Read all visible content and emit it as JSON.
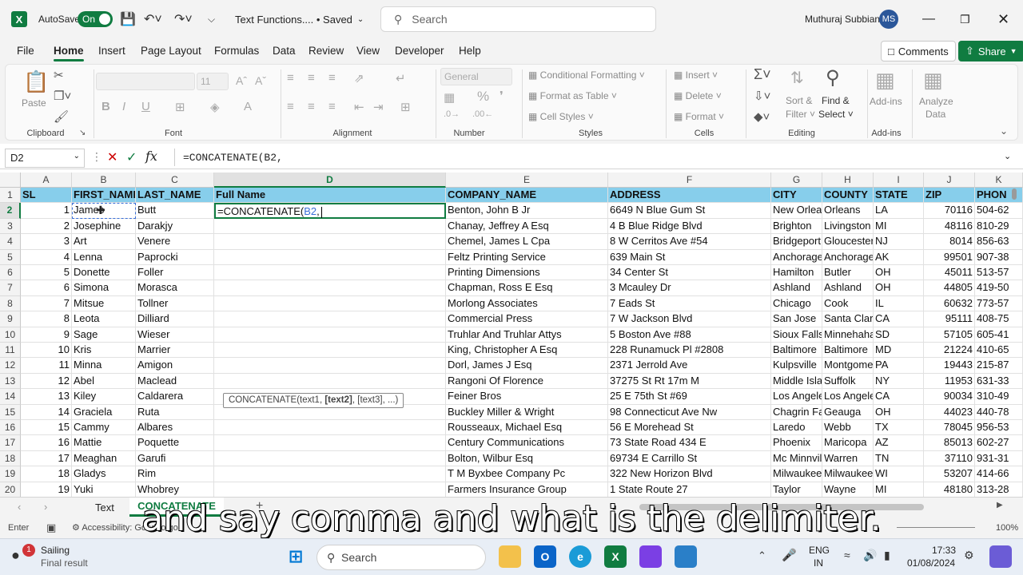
{
  "titlebar": {
    "autosave_label": "AutoSave",
    "autosave_state": "On",
    "doc_title": "Text Functions....  • Saved",
    "search_placeholder": "Search",
    "user_name": "Muthuraj Subbian",
    "user_initials": "MS"
  },
  "menu": {
    "tabs": [
      "File",
      "Home",
      "Insert",
      "Page Layout",
      "Formulas",
      "Data",
      "Review",
      "View",
      "Developer",
      "Help"
    ],
    "comments": "Comments",
    "share": "Share"
  },
  "ribbon": {
    "clipboard": {
      "label": "Clipboard",
      "paste": "Paste"
    },
    "font": {
      "label": "Font",
      "size": "11"
    },
    "alignment": {
      "label": "Alignment"
    },
    "number": {
      "label": "Number",
      "format": "General"
    },
    "styles": {
      "label": "Styles",
      "conditional": "Conditional Formatting",
      "format_table": "Format as Table",
      "cell_styles": "Cell Styles"
    },
    "cells": {
      "label": "Cells",
      "insert": "Insert",
      "delete": "Delete",
      "format": "Format"
    },
    "editing": {
      "label": "Editing",
      "sort": "Sort &",
      "filter": "Filter",
      "find": "Find &",
      "select": "Select"
    },
    "addins": {
      "label": "Add-ins",
      "addins": "Add-ins",
      "analyze": "Analyze",
      "data": "Data"
    }
  },
  "formula_bar": {
    "name_box": "D2",
    "formula": "=CONCATENATE(B2,"
  },
  "sheet": {
    "columns": [
      "A",
      "B",
      "C",
      "D",
      "E",
      "F",
      "G",
      "H",
      "I",
      "J",
      "K"
    ],
    "headers": [
      "SL",
      "FIRST_NAME",
      "LAST_NAME",
      "Full Name",
      "COMPANY_NAME",
      "ADDRESS",
      "CITY",
      "COUNTY",
      "STATE",
      "ZIP",
      "PHON"
    ],
    "rows": [
      [
        "1",
        "James",
        "Butt",
        "",
        "Benton, John B Jr",
        "6649 N Blue Gum St",
        "New Orleans",
        "Orleans",
        "LA",
        "70116",
        "504-62"
      ],
      [
        "2",
        "Josephine",
        "Darakjy",
        "",
        "Chanay, Jeffrey A Esq",
        "4 B Blue Ridge Blvd",
        "Brighton",
        "Livingston",
        "MI",
        "48116",
        "810-29"
      ],
      [
        "3",
        "Art",
        "Venere",
        "",
        "Chemel, James L Cpa",
        "8 W Cerritos Ave #54",
        "Bridgeport",
        "Gloucester",
        "NJ",
        "8014",
        "856-63"
      ],
      [
        "4",
        "Lenna",
        "Paprocki",
        "",
        "Feltz Printing Service",
        "639 Main St",
        "Anchorage",
        "Anchorage",
        "AK",
        "99501",
        "907-38"
      ],
      [
        "5",
        "Donette",
        "Foller",
        "",
        "Printing Dimensions",
        "34 Center St",
        "Hamilton",
        "Butler",
        "OH",
        "45011",
        "513-57"
      ],
      [
        "6",
        "Simona",
        "Morasca",
        "",
        "Chapman, Ross E Esq",
        "3 Mcauley Dr",
        "Ashland",
        "Ashland",
        "OH",
        "44805",
        "419-50"
      ],
      [
        "7",
        "Mitsue",
        "Tollner",
        "",
        "Morlong Associates",
        "7 Eads St",
        "Chicago",
        "Cook",
        "IL",
        "60632",
        "773-57"
      ],
      [
        "8",
        "Leota",
        "Dilliard",
        "",
        "Commercial Press",
        "7 W Jackson Blvd",
        "San Jose",
        "Santa Clara",
        "CA",
        "95111",
        "408-75"
      ],
      [
        "9",
        "Sage",
        "Wieser",
        "",
        "Truhlar And Truhlar Attys",
        "5 Boston Ave #88",
        "Sioux Falls",
        "Minnehaha",
        "SD",
        "57105",
        "605-41"
      ],
      [
        "10",
        "Kris",
        "Marrier",
        "",
        "King, Christopher A Esq",
        "228 Runamuck Pl #2808",
        "Baltimore",
        "Baltimore",
        "MD",
        "21224",
        "410-65"
      ],
      [
        "11",
        "Minna",
        "Amigon",
        "",
        "Dorl, James J Esq",
        "2371 Jerrold Ave",
        "Kulpsville",
        "Montgomery",
        "PA",
        "19443",
        "215-87"
      ],
      [
        "12",
        "Abel",
        "Maclead",
        "",
        "Rangoni Of Florence",
        "37275 St  Rt 17m M",
        "Middle Island",
        "Suffolk",
        "NY",
        "11953",
        "631-33"
      ],
      [
        "13",
        "Kiley",
        "Caldarera",
        "",
        "Feiner Bros",
        "25 E 75th St #69",
        "Los Angeles",
        "Los Angeles",
        "CA",
        "90034",
        "310-49"
      ],
      [
        "14",
        "Graciela",
        "Ruta",
        "",
        "Buckley Miller & Wright",
        "98 Connecticut Ave Nw",
        "Chagrin Falls",
        "Geauga",
        "OH",
        "44023",
        "440-78"
      ],
      [
        "15",
        "Cammy",
        "Albares",
        "",
        "Rousseaux, Michael Esq",
        "56 E Morehead St",
        "Laredo",
        "Webb",
        "TX",
        "78045",
        "956-53"
      ],
      [
        "16",
        "Mattie",
        "Poquette",
        "",
        "Century Communications",
        "73 State Road 434 E",
        "Phoenix",
        "Maricopa",
        "AZ",
        "85013",
        "602-27"
      ],
      [
        "17",
        "Meaghan",
        "Garufi",
        "",
        "Bolton, Wilbur Esq",
        "69734 E Carrillo St",
        "Mc Minnville",
        "Warren",
        "TN",
        "37110",
        "931-31"
      ],
      [
        "18",
        "Gladys",
        "Rim",
        "",
        "T M Byxbee Company Pc",
        "322 New Horizon Blvd",
        "Milwaukee",
        "Milwaukee",
        "WI",
        "53207",
        "414-66"
      ],
      [
        "19",
        "Yuki",
        "Whobrey",
        "",
        "Farmers Insurance Group",
        "1 State Route 27",
        "Taylor",
        "Wayne",
        "MI",
        "48180",
        "313-28"
      ]
    ],
    "active_cell_text": "=CONCATENATE(",
    "active_cell_ref": "B2",
    "active_cell_tail": ",",
    "tooltip": "CONCATENATE(text1, [text2], [text3], ...)"
  },
  "sheet_tabs": [
    "Text",
    "CONCATENATE"
  ],
  "status": {
    "mode": "Enter",
    "accessibility": "Accessibility: Good to go",
    "zoom": "100%"
  },
  "caption": "and say comma and what is the delimiter.",
  "taskbar": {
    "weather_title": "Sailing",
    "weather_sub": "Final result",
    "badge": "1",
    "search": "Search",
    "lang1": "ENG",
    "lang2": "IN",
    "time": "17:33",
    "date": "01/08/2024"
  }
}
